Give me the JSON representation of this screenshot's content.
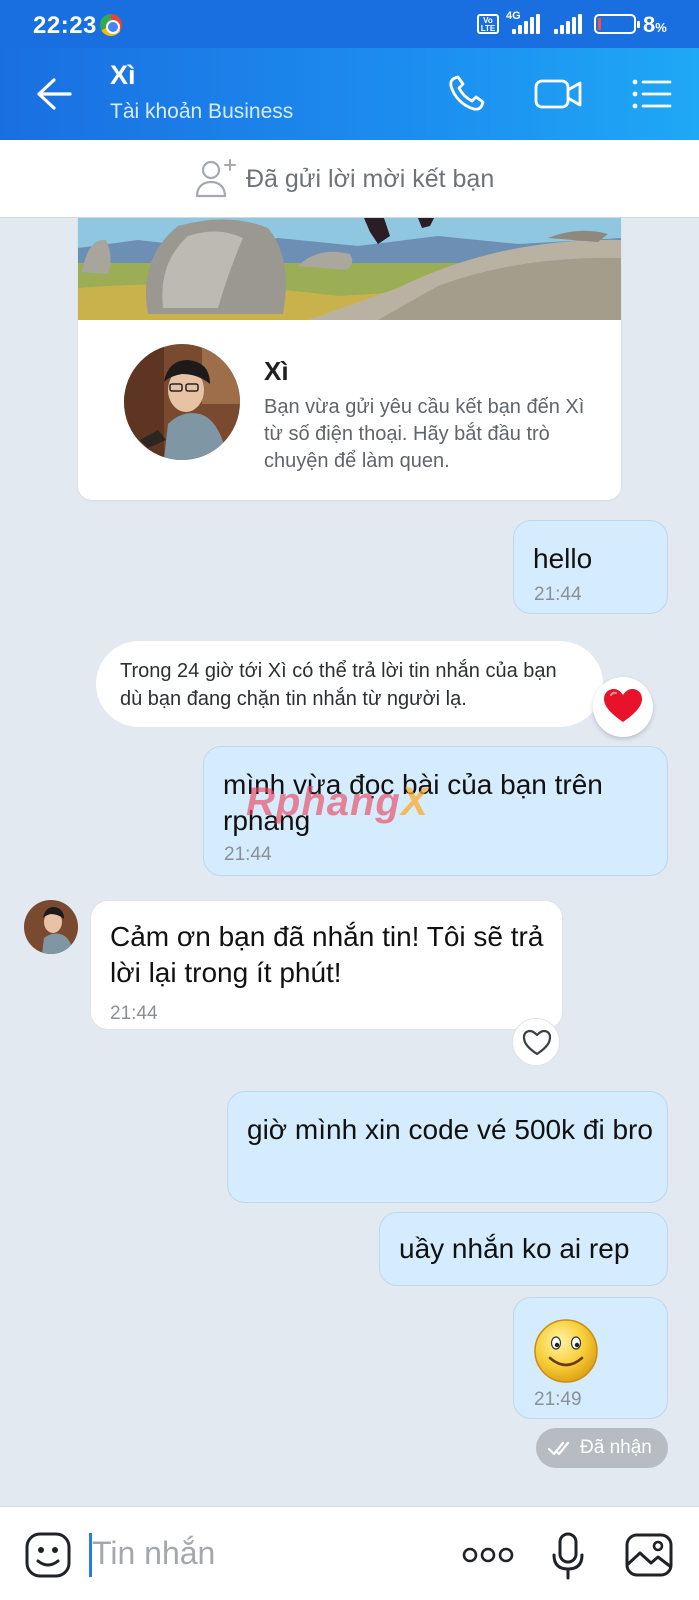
{
  "status_bar": {
    "time": "22:23",
    "volte": "Vo LTE",
    "network": "4G",
    "battery_pct": "8",
    "battery_sym": "%",
    "battery_level": 0.08
  },
  "header": {
    "contact_name": "Xì",
    "subtitle": "Tài khoản Business",
    "icons": [
      "back-arrow-icon",
      "phone-icon",
      "video-call-icon",
      "menu-list-icon"
    ]
  },
  "friend_request": {
    "text": "Đã gửi lời mời kết bạn"
  },
  "profile_card": {
    "name": "Xì",
    "description": "Bạn vừa gửi yêu cầu kết bạn đến Xì từ số điện thoại. Hãy bắt đầu trò chuyện để làm quen."
  },
  "messages": [
    {
      "from": "me",
      "text": "hello",
      "time": "21:44"
    },
    {
      "from": "system",
      "text": "Trong 24 giờ tới Xì có thể trả lời tin nhắn của bạn dù bạn đang chặn tin nhắn từ người lạ.",
      "reaction": "heart"
    },
    {
      "from": "me",
      "text": "mình vừa đọc bài của bạn trên rphang",
      "time": "21:44"
    },
    {
      "from": "them",
      "text": "Cảm ơn bạn đã nhắn tin! Tôi sẽ trả lời lại trong ít phút!",
      "time": "21:44"
    },
    {
      "from": "me",
      "text": "giờ mình xin code vé 500k đi bro"
    },
    {
      "from": "me",
      "text": "uầy nhắn ko ai rep"
    },
    {
      "from": "me",
      "sticker": "smiley-emoji",
      "time": "21:49"
    }
  ],
  "watermark": {
    "main": "Rphang",
    "suffix": "X"
  },
  "seen_status": "Đã nhận",
  "input": {
    "placeholder": "Tin nhắn"
  },
  "colors": {
    "header_blue": "#1a6fe0",
    "my_bubble": "#d4ecfd",
    "background": "#e2e9f1"
  }
}
